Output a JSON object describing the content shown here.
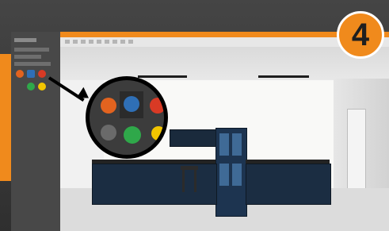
{
  "step": {
    "number": "4"
  },
  "palette": {
    "swatches": [
      {
        "name": "orange",
        "color": "#e2631f"
      },
      {
        "name": "blue",
        "color": "#2f6fb6"
      },
      {
        "name": "red",
        "color": "#d93a25"
      },
      {
        "name": "green",
        "color": "#2fa84a"
      },
      {
        "name": "yellow",
        "color": "#f2c500"
      }
    ]
  },
  "accent_color": "#f08a1c"
}
